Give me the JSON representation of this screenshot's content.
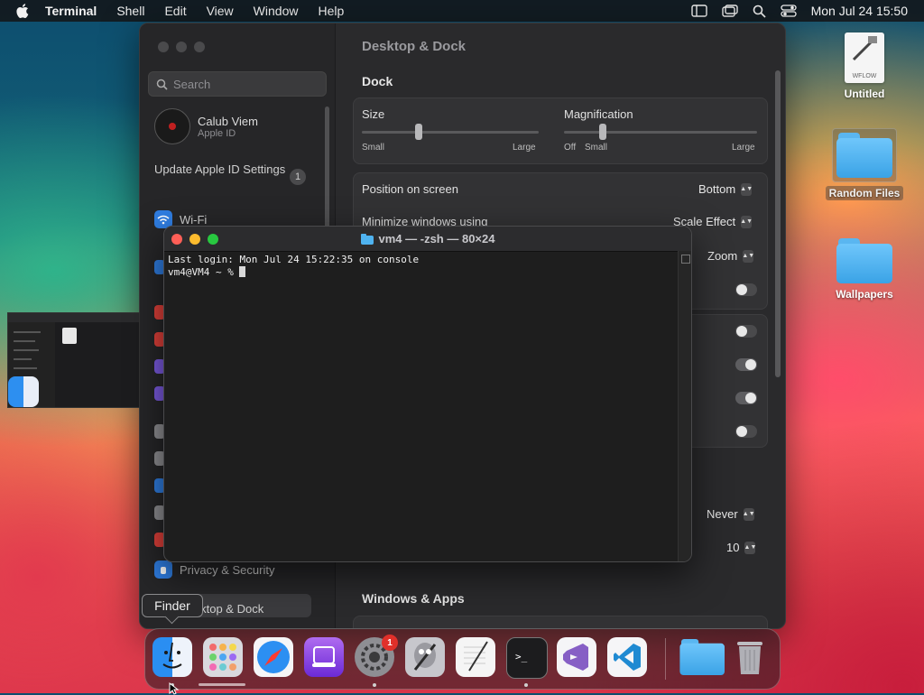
{
  "menubar": {
    "app_name": "Terminal",
    "items": [
      "Shell",
      "Edit",
      "View",
      "Window",
      "Help"
    ],
    "datetime": "Mon Jul 24  15:50"
  },
  "settings": {
    "title": "Desktop & Dock",
    "search_placeholder": "Search",
    "profile_name": "Calub Viem",
    "profile_sub": "Apple ID",
    "update_label": "Update Apple ID Settings",
    "update_badge": "1",
    "sidebar_items": {
      "wifi": "Wi-Fi",
      "privacy": "Privacy & Security",
      "desktop_dock": "Desktop & Dock"
    },
    "dock_section": "Dock",
    "size_label": "Size",
    "size_min": "Small",
    "size_max": "Large",
    "size_value": 0.32,
    "magnification_label": "Magnification",
    "mag_off": "Off",
    "mag_min": "Small",
    "mag_max": "Large",
    "mag_value": 0.2,
    "position_label": "Position on screen",
    "position_value": "Bottom",
    "minimize_label": "Minimize windows using",
    "minimize_value": "Scale Effect",
    "zoom_value": "Zoom",
    "never_value": "Never",
    "ten_value": "10",
    "windows_apps_section": "Windows & Apps",
    "toggles": [
      false,
      false,
      true,
      true,
      false
    ]
  },
  "terminal": {
    "title": "vm4 — -zsh — 80×24",
    "line1": "Last login: Mon Jul 24 15:22:35 on console",
    "prompt": "vm4@VM4 ~ % "
  },
  "desktop": {
    "untitled_label": "Untitled",
    "untitled_doc_text": "WFLOW",
    "random_files_label": "Random Files",
    "wallpapers_label": "Wallpapers"
  },
  "dock": {
    "tooltip": "Finder",
    "notification_count": "1",
    "apps": [
      "Finder",
      "Launchpad",
      "Safari",
      "Podcasts",
      "System Settings",
      "Automator",
      "TextEdit",
      "Terminal",
      "Visual Studio",
      "Visual Studio Code",
      "Downloads",
      "Trash"
    ]
  },
  "colors": {
    "close": "#ff5f57",
    "minimize": "#febc2e",
    "zoom": "#28c840",
    "folder_blue": "#4fb3f0"
  }
}
